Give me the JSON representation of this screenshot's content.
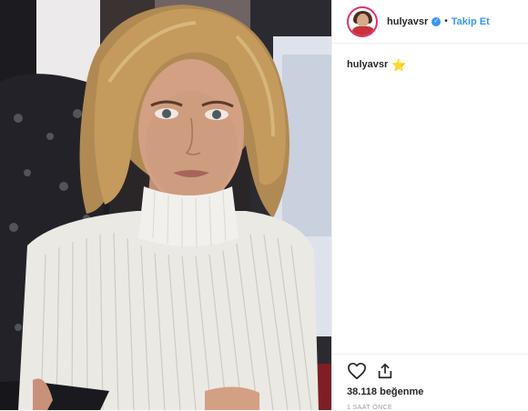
{
  "post": {
    "username": "hulyavsr",
    "verified_icon": "verified-badge-icon",
    "separator": "•",
    "follow_label": "Takip Et",
    "caption_user": "hulyavsr",
    "caption_star": "⭐",
    "likes": "38.118 beğenme",
    "time_ago": "1 SAAT ÖNCE"
  },
  "icons": {
    "like": "heart-icon",
    "share": "share-icon"
  },
  "colors": {
    "accent": "#3897f0",
    "text": "#262626",
    "muted": "#999999",
    "border": "#efefef"
  }
}
